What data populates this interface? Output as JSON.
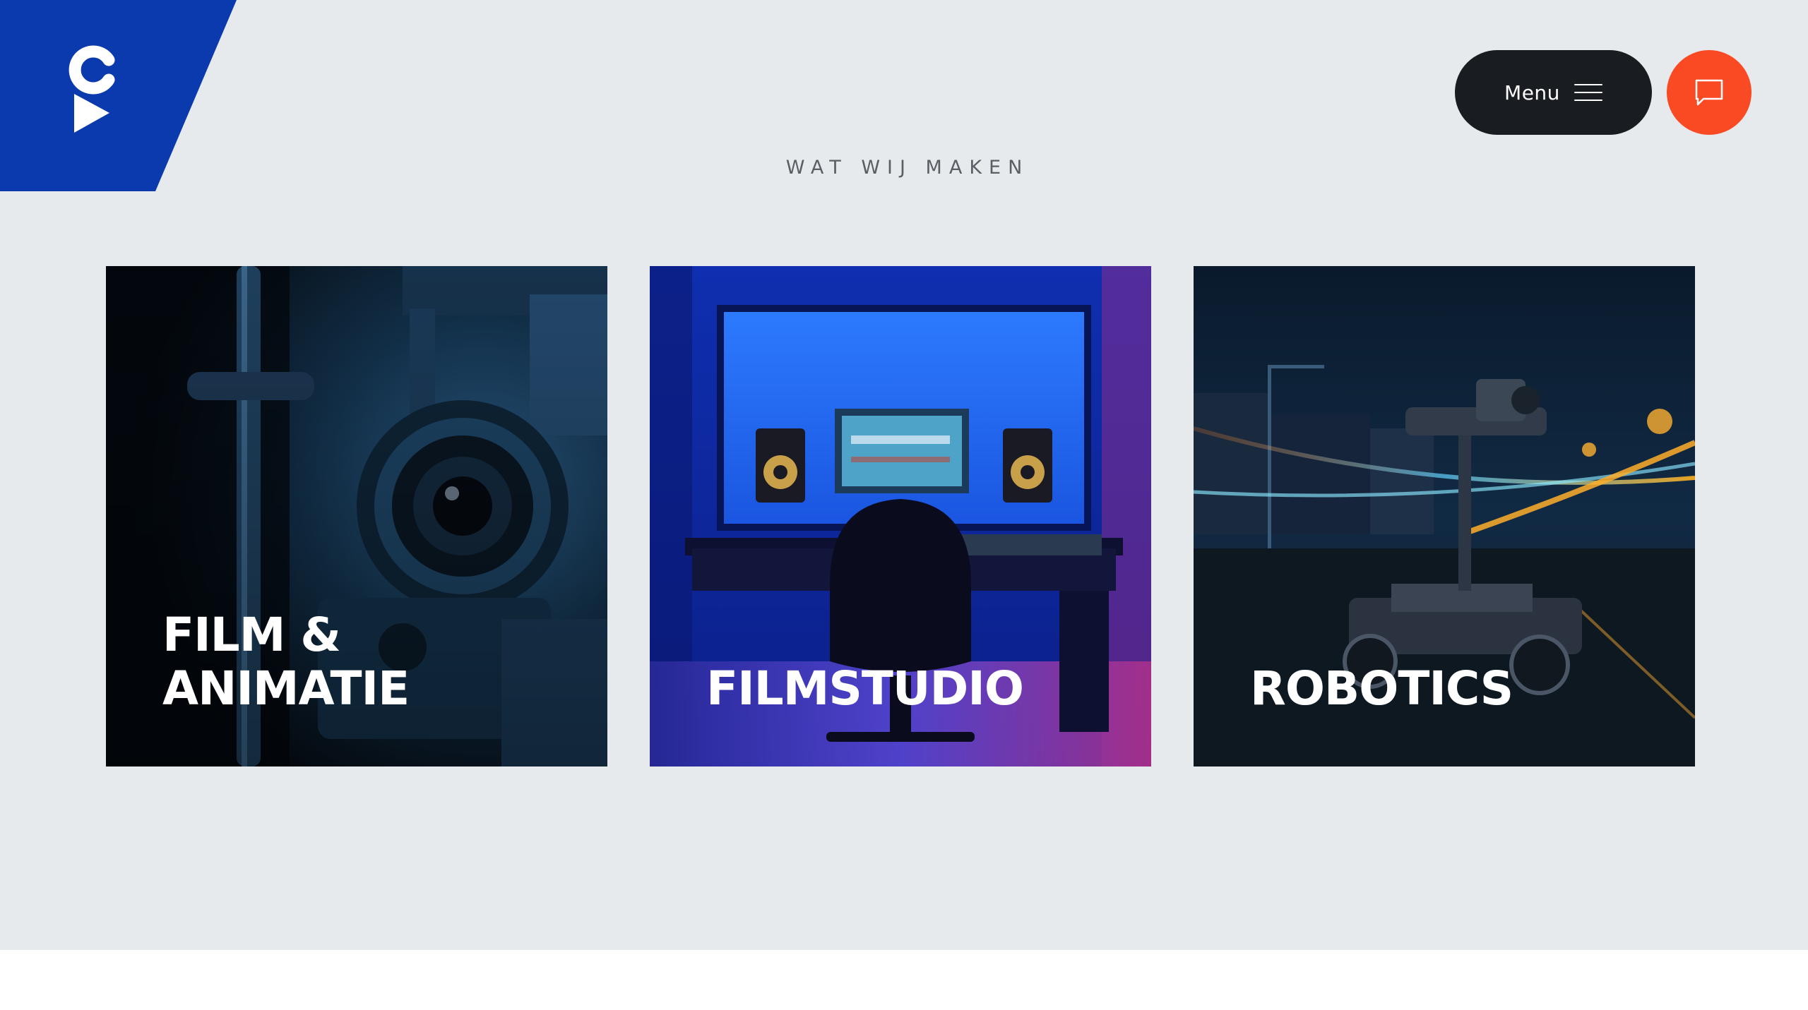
{
  "header": {
    "menu_label": "Menu",
    "menu_icon": "hamburger-icon",
    "chat_icon": "chat-bubble-icon",
    "logo_icon": "c-play-logo-icon"
  },
  "section": {
    "eyebrow": "WAT WIJ MAKEN"
  },
  "cards": [
    {
      "title": "FILM &\nANIMATIE",
      "image": "camera-lens-image"
    },
    {
      "title": "FILMSTUDIO",
      "image": "studio-desk-image"
    },
    {
      "title": "ROBOTICS",
      "image": "robot-camera-car-image"
    }
  ],
  "colors": {
    "brand_blue": "#0a3aad",
    "menu_dark": "#191c21",
    "chat_orange": "#fa4a24",
    "background": "#e7eaec"
  }
}
